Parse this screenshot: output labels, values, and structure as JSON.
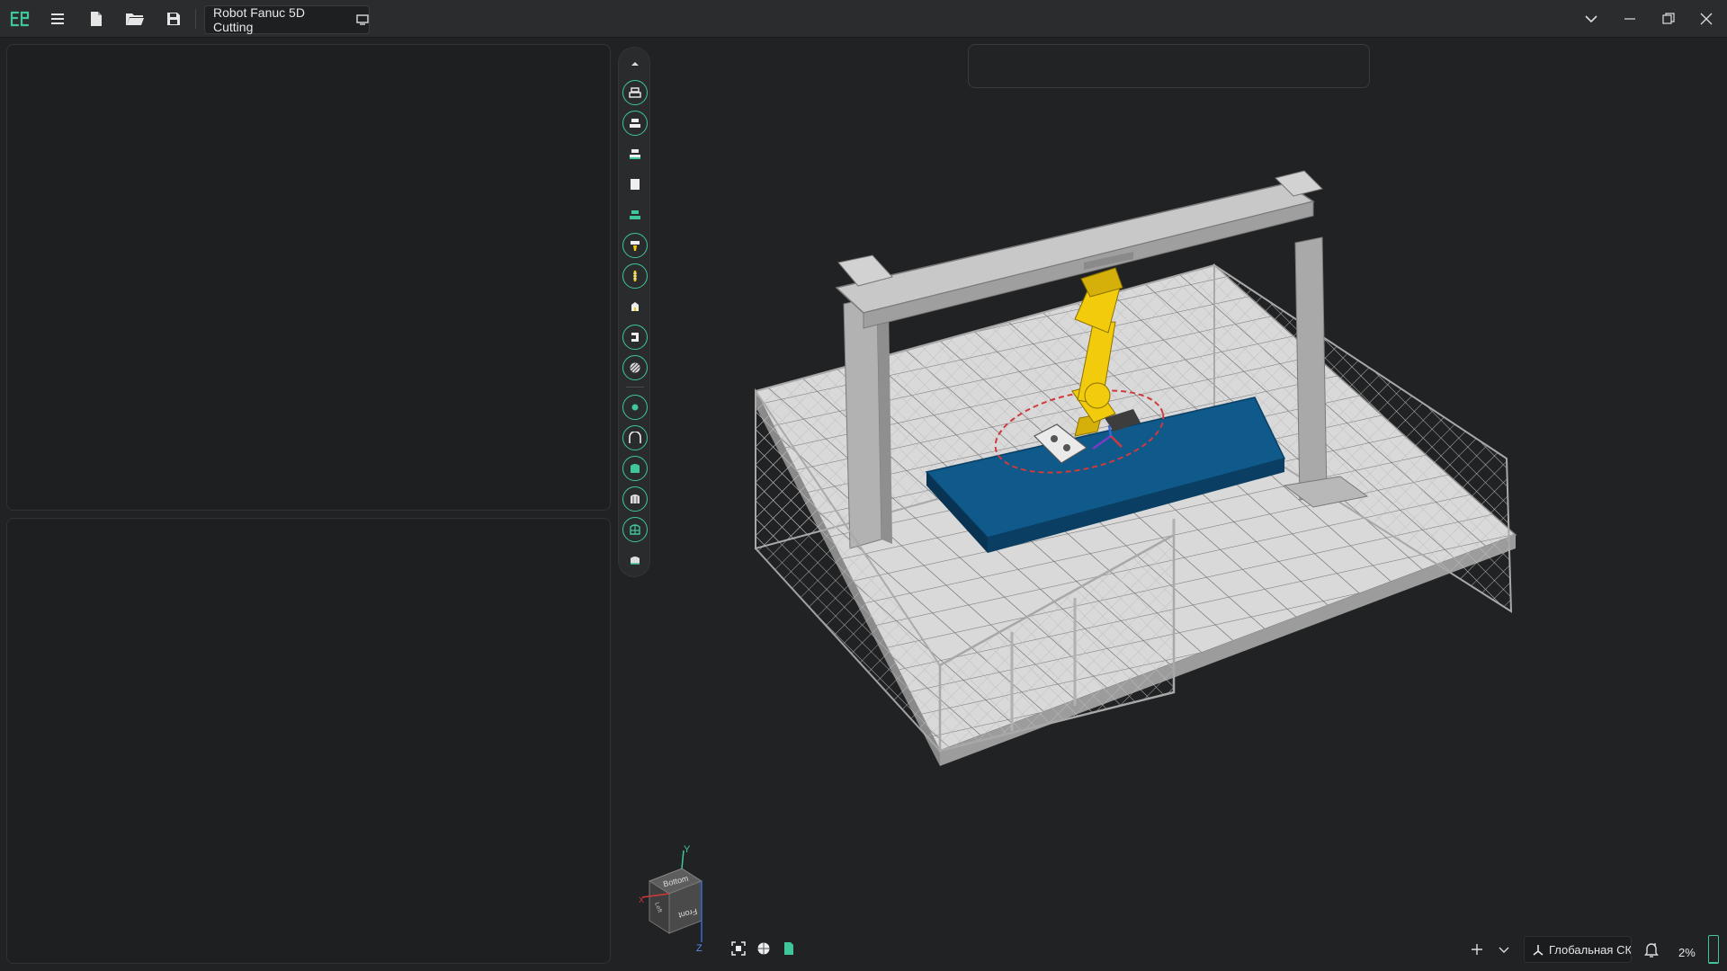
{
  "app": {
    "document_tab": {
      "title": "Robot Fanuc 5D Cutting"
    }
  },
  "toolbar": {
    "menu_icon": "menu-icon",
    "new_icon": "new-file-icon",
    "open_icon": "open-folder-icon",
    "save_icon": "save-icon"
  },
  "vertical_toolbar": {
    "items": [
      "collapse-up-icon",
      "roughing-icon",
      "waterline-icon",
      "rest-machining-icon",
      "plane-finishing-icon",
      "drilling-icon",
      "probe-icon",
      "tool-holder-icon",
      "contour-icon",
      "hatching-icon",
      "point-icon",
      "curve-icon",
      "surface-icon",
      "flowline-icon",
      "morph-icon",
      "swarf-icon"
    ]
  },
  "viewcube": {
    "top_face": "Bottom",
    "front_face": "Front",
    "side_face": "Left",
    "axis_y": "Y",
    "axis_z": "Z",
    "axis_x": "X"
  },
  "status": {
    "coordinate_system": "Глобальная СК",
    "zoom": "2%",
    "progress_fraction": 0.05
  },
  "colors": {
    "accent": "#3fc79b",
    "table_blue": "#0f5a8a",
    "robot_yellow": "#f2cc0c"
  }
}
